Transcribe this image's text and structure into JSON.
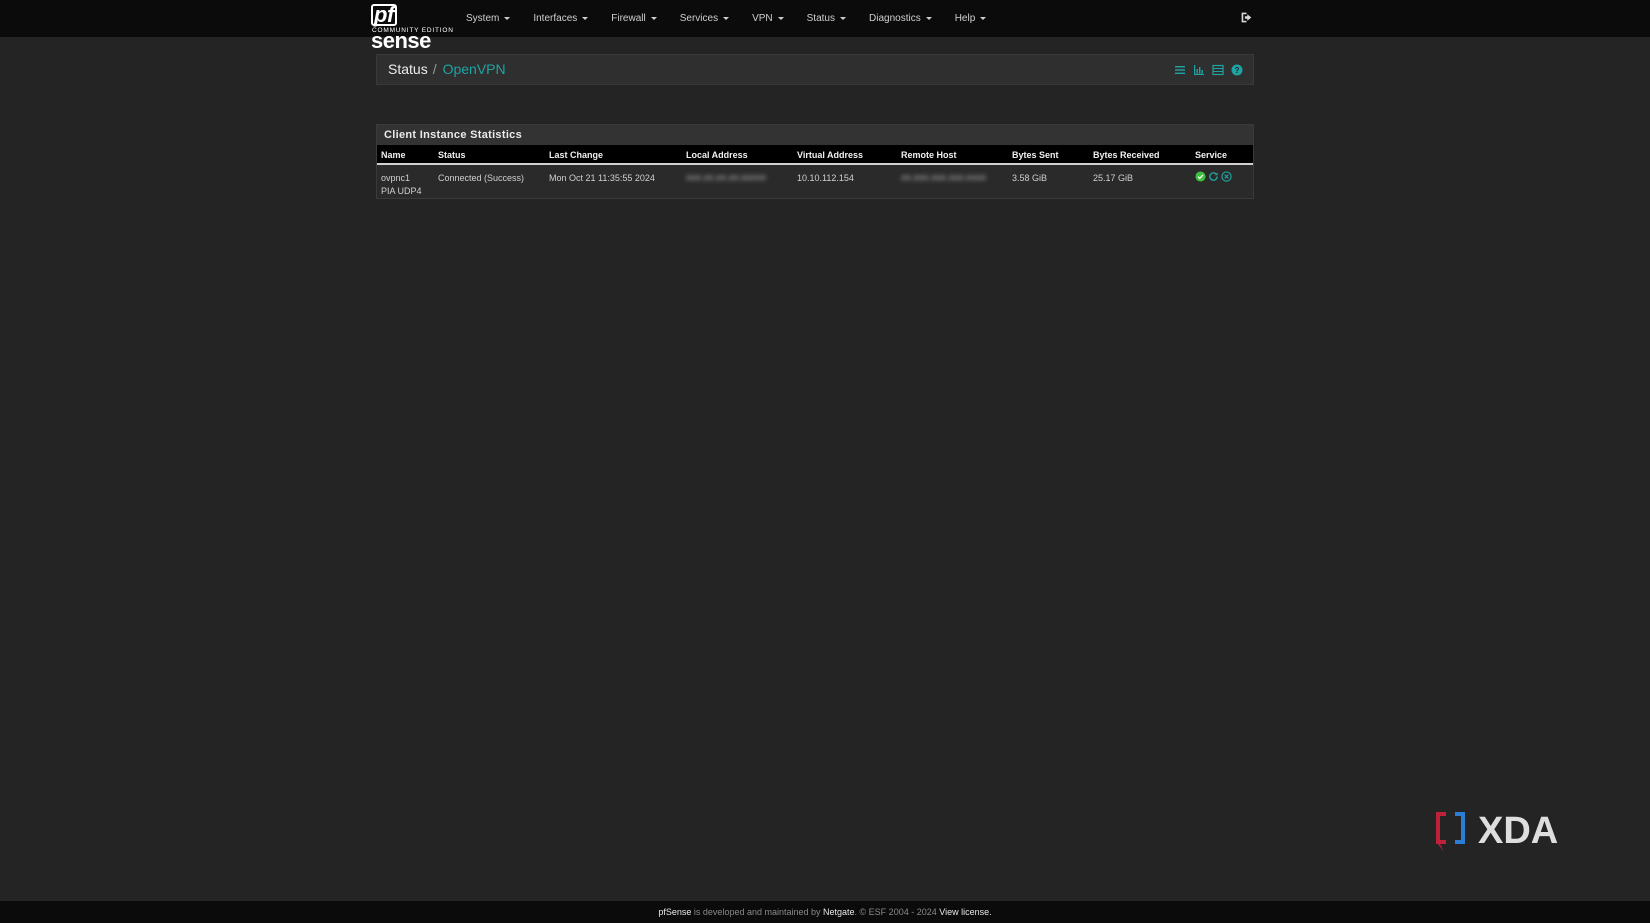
{
  "nav": {
    "logo_text": "pfsense",
    "logo_subtitle": "COMMUNITY EDITION",
    "menu": [
      {
        "label": "System"
      },
      {
        "label": "Interfaces"
      },
      {
        "label": "Firewall"
      },
      {
        "label": "Services"
      },
      {
        "label": "VPN"
      },
      {
        "label": "Status"
      },
      {
        "label": "Diagnostics"
      },
      {
        "label": "Help"
      }
    ],
    "logout_icon": "sign-out-icon"
  },
  "breadcrumb": {
    "parent": "Status",
    "separator": "/",
    "current": "OpenVPN",
    "icons": [
      "list-icon",
      "bar-chart-icon",
      "table-icon",
      "help-icon"
    ]
  },
  "panel": {
    "title": "Client Instance Statistics",
    "columns": [
      "Name",
      "Status",
      "Last Change",
      "Local Address",
      "Virtual Address",
      "Remote Host",
      "Bytes Sent",
      "Bytes Received",
      "Service"
    ],
    "rows": [
      {
        "name_line1": "ovpnc1",
        "name_line2": "PIA UDP4",
        "status": "Connected (Success)",
        "last_change": "Mon Oct 21 11:35:55 2024",
        "local_address": "[blurred]",
        "virtual_address": "10.10.112.154",
        "remote_host": "[blurred]",
        "bytes_sent": "3.58 GiB",
        "bytes_received": "25.17 GiB",
        "service_icons": [
          "check-circle-icon",
          "restart-icon",
          "stop-circle-icon"
        ]
      }
    ]
  },
  "watermark": {
    "text": "XDA"
  },
  "footer": {
    "brand": "pfSense",
    "text1": " is developed and maintained by ",
    "company": "Netgate",
    "text2": ". © ESF 2004 - 2024 ",
    "license_link": "View license."
  },
  "colors": {
    "background": "#242424",
    "navbar": "#0b0b0b",
    "accent": "#1fa3a3",
    "service_green": "#3fbf3f"
  }
}
